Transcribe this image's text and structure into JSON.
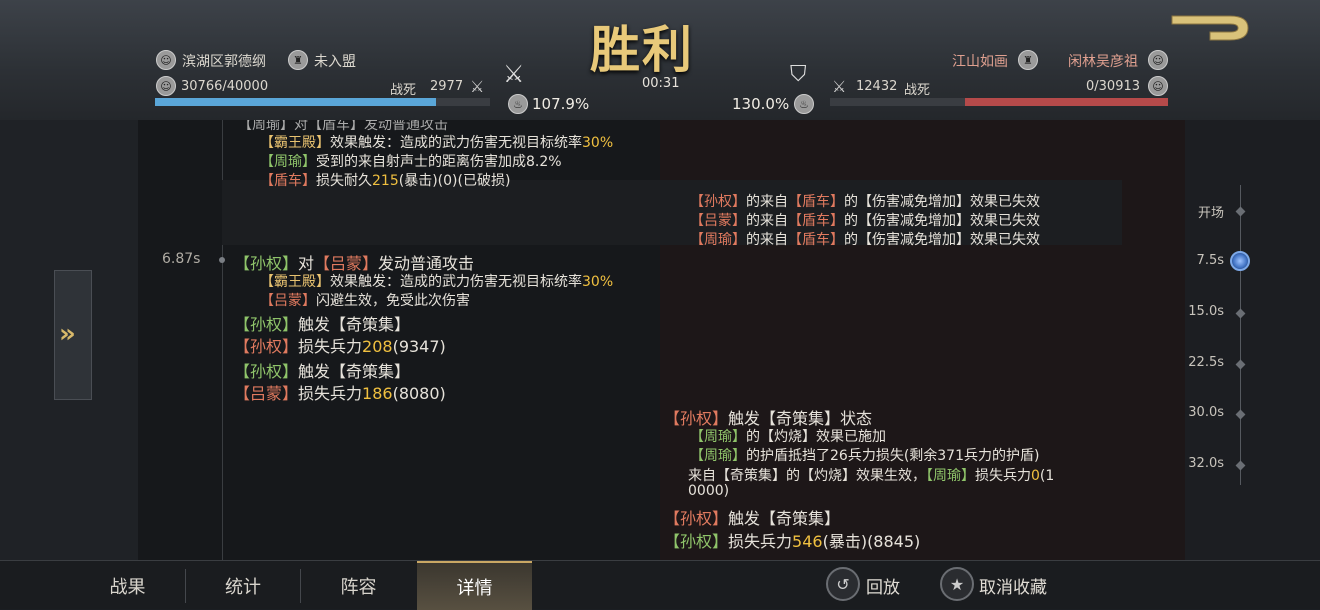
{
  "header": {
    "title": "胜利",
    "time": "00:31",
    "left_player": {
      "name": "滨湖区郭德纲",
      "alliance": "未入盟",
      "troops": "30766/40000",
      "dead_label": "战死",
      "dead": "2977",
      "pct": "107.9%",
      "bar_fill": 0.838
    },
    "right_player": {
      "name": "闲林吴彦祖",
      "alliance": "江山如画",
      "troops": "0/30913",
      "dead_label": "战死",
      "dead": "12432",
      "pct": "130.0%",
      "bar_fill": 0.6
    }
  },
  "log": {
    "cutoff_line": "【周瑜】对【盾车】发动普通攻击",
    "left_lines_1": [
      {
        "tag": "【霸王殿】",
        "tag_color": "#e8c270",
        "text": "效果触发：造成的武力伤害无视目标统率",
        "num": "30%"
      },
      {
        "tag": "【周瑜】",
        "tag_color": "#8fc46a",
        "text": "受到的来自射声士的距离伤害加成8.2%",
        "num": ""
      },
      {
        "tag": "【盾车】",
        "tag_color": "#e07a5f",
        "text": "损失耐久",
        "num": "215",
        "suffix": "(暴击)(0)(已破损)"
      }
    ],
    "right_lines_1": [
      {
        "tag": "【孙权】",
        "mid": "的来自",
        "tag2": "【盾车】",
        "text": "的【伤害减免增加】效果已失效"
      },
      {
        "tag": "【吕蒙】",
        "mid": "的来自",
        "tag2": "【盾车】",
        "text": "的【伤害减免增加】效果已失效"
      },
      {
        "tag": "【周瑜】",
        "mid": "的来自",
        "tag2": "【盾车】",
        "text": "的【伤害减免增加】效果已失效"
      }
    ],
    "time_marker": "6.87s",
    "attack_line": {
      "a": "【孙权】",
      "mid": "对",
      "b": "【吕蒙】",
      "text": "发动普通攻击"
    },
    "attack_sub1": {
      "tag": "【霸王殿】",
      "text": "效果触发：造成的武力伤害无视目标统率",
      "num": "30%"
    },
    "attack_sub2": {
      "tag": "【吕蒙】",
      "text": "闪避生效，免受此次伤害"
    },
    "left_events": [
      {
        "tag": "【孙权】",
        "tag_color": "#8fc46a",
        "text": "触发【奇策集】",
        "num": "",
        "suffix": ""
      },
      {
        "tag": "【孙权】",
        "tag_color": "#e07a5f",
        "text": "损失兵力",
        "num": "208",
        "suffix": "(9347)"
      },
      {
        "tag": "【孙权】",
        "tag_color": "#8fc46a",
        "text": "触发【奇策集】",
        "num": "",
        "suffix": ""
      },
      {
        "tag": "【吕蒙】",
        "tag_color": "#e07a5f",
        "text": "损失兵力",
        "num": "186",
        "suffix": "(8080)"
      }
    ],
    "right_event_head": {
      "tag": "【孙权】",
      "text": "触发【奇策集】状态"
    },
    "right_event_sub1": {
      "tag": "【周瑜】",
      "text": "的【灼烧】效果已施加"
    },
    "right_event_sub2": {
      "tag": "【周瑜】",
      "text": "的护盾抵挡了26兵力损失(剩余371兵力的护盾)"
    },
    "right_event_sub3": {
      "pre": "来自【奇策集】的【灼烧】效果生效，",
      "tag": "【周瑜】",
      "text": "损失兵力",
      "num": "0",
      "suffix1": "(1",
      "suffix2": "0000)"
    },
    "right_events_tail": [
      {
        "tag": "【孙权】",
        "tag_color": "#e07a5f",
        "text": "触发【奇策集】",
        "num": "",
        "suffix": ""
      },
      {
        "tag": "【孙权】",
        "tag_color": "#8fc46a",
        "text": "损失兵力",
        "num": "546",
        "suffix": "(暴击)(8845)"
      }
    ]
  },
  "timeline": [
    "开场",
    "7.5s",
    "15.0s",
    "22.5s",
    "30.0s",
    "32.0s"
  ],
  "bottom": {
    "tabs": [
      "战果",
      "统计",
      "阵容",
      "详情"
    ],
    "replay": "回放",
    "unfav": "取消收藏"
  },
  "colors": {
    "green": "#8fc46a",
    "red": "#e07a5f",
    "gold": "#e8c270",
    "number": "#f0c040",
    "bar_left": "#5aa6d8",
    "bar_right": "#b54a4a"
  }
}
